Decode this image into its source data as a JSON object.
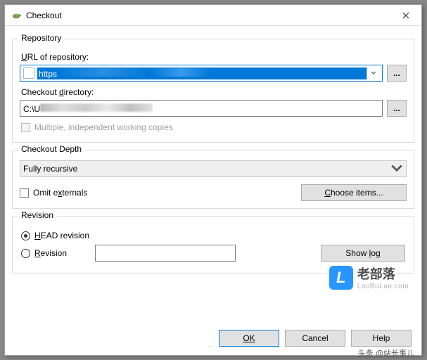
{
  "window": {
    "title": "Checkout"
  },
  "repository": {
    "group_label": "Repository",
    "url_label": "URL of repository:",
    "url_prefix": "https",
    "dir_label": "Checkout directory:",
    "dir_prefix": "C:\\U",
    "multi_label": "Multiple, independent working copies",
    "browse": "..."
  },
  "depth": {
    "group_label": "Checkout Depth",
    "value": "Fully recursive",
    "omit_label": "Omit externals",
    "choose_label": "Choose items..."
  },
  "revision": {
    "group_label": "Revision",
    "head_label": "HEAD revision",
    "rev_label": "Revision",
    "showlog_label": "Show log"
  },
  "footer": {
    "ok": "OK",
    "cancel": "Cancel",
    "help": "Help"
  },
  "watermark": {
    "cn": "老部落",
    "url": "LaoBuLuo.com"
  },
  "signature": "头条 @站长事儿"
}
